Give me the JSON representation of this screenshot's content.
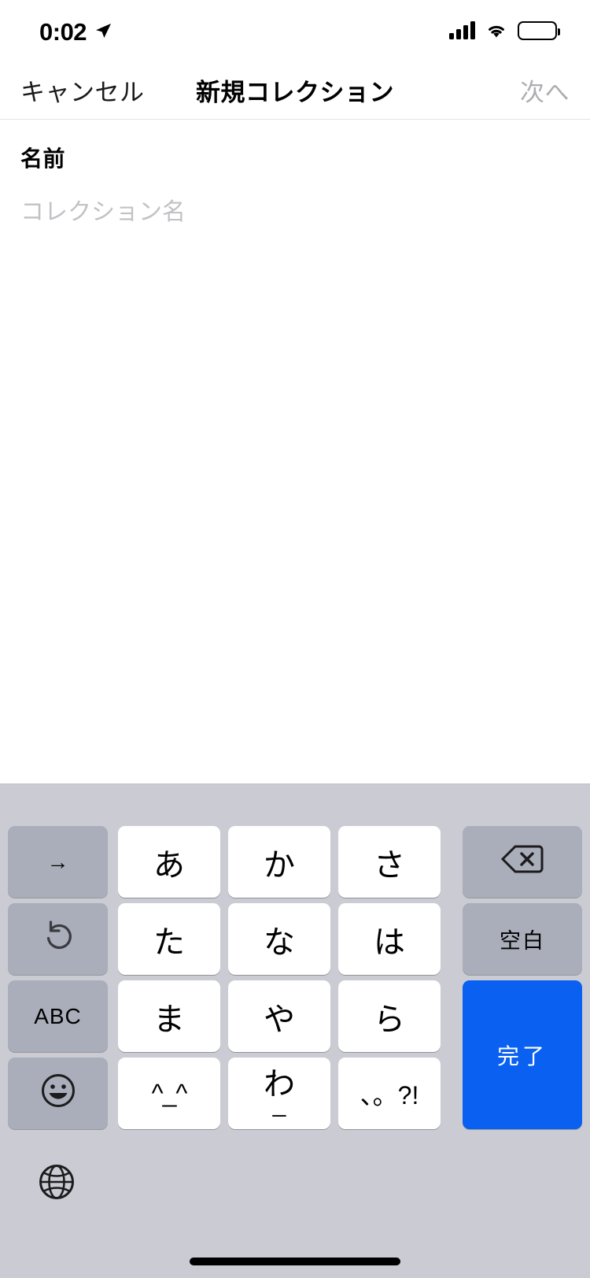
{
  "status_bar": {
    "time": "0:02",
    "location_icon": "location-arrow-icon",
    "signal_icon": "cellular-signal-icon",
    "wifi_icon": "wifi-icon",
    "battery_icon": "battery-full-icon"
  },
  "nav_bar": {
    "cancel_label": "キャンセル",
    "title": "新規コレクション",
    "next_label": "次へ",
    "next_disabled_color": "#aeaeb2"
  },
  "form": {
    "name_label": "名前",
    "name_value": "",
    "name_placeholder": "コレクション名"
  },
  "keyboard": {
    "background_color": "#cbcbd3",
    "return_key_color": "#0a60f0",
    "function_key_color": "#a9aeba",
    "letter_key_color": "#ffffff",
    "rows": [
      [
        {
          "name": "next-candidate-key",
          "label": "→",
          "type": "fn"
        },
        {
          "name": "key-a",
          "label": "あ",
          "type": "letter"
        },
        {
          "name": "key-ka",
          "label": "か",
          "type": "letter"
        },
        {
          "name": "key-sa",
          "label": "さ",
          "type": "letter"
        },
        {
          "name": "delete-key",
          "label": "",
          "type": "fn",
          "icon": "delete-backward-icon"
        }
      ],
      [
        {
          "name": "undo-key",
          "label": "",
          "type": "fn",
          "icon": "undo-arrow-icon"
        },
        {
          "name": "key-ta",
          "label": "た",
          "type": "letter"
        },
        {
          "name": "key-na",
          "label": "な",
          "type": "letter"
        },
        {
          "name": "key-ha",
          "label": "は",
          "type": "letter"
        },
        {
          "name": "space-key",
          "label": "空白",
          "type": "fn"
        }
      ],
      [
        {
          "name": "abc-key",
          "label": "ABC",
          "type": "fn"
        },
        {
          "name": "key-ma",
          "label": "ま",
          "type": "letter"
        },
        {
          "name": "key-ya",
          "label": "や",
          "type": "letter"
        },
        {
          "name": "key-ra",
          "label": "ら",
          "type": "letter"
        },
        {
          "name": "done-key",
          "label": "完了",
          "type": "return"
        }
      ],
      [
        {
          "name": "emoji-key",
          "label": "",
          "type": "fn",
          "icon": "smiley-face-icon"
        },
        {
          "name": "key-kaomoji",
          "label": "^_^",
          "type": "letter"
        },
        {
          "name": "key-wa",
          "label": "わ",
          "sub": "_",
          "type": "letter"
        },
        {
          "name": "key-punctuation",
          "label": "、。?!",
          "type": "letter"
        }
      ]
    ],
    "globe_key": {
      "name": "globe-key",
      "icon": "globe-icon"
    }
  },
  "home_indicator": "home-indicator"
}
